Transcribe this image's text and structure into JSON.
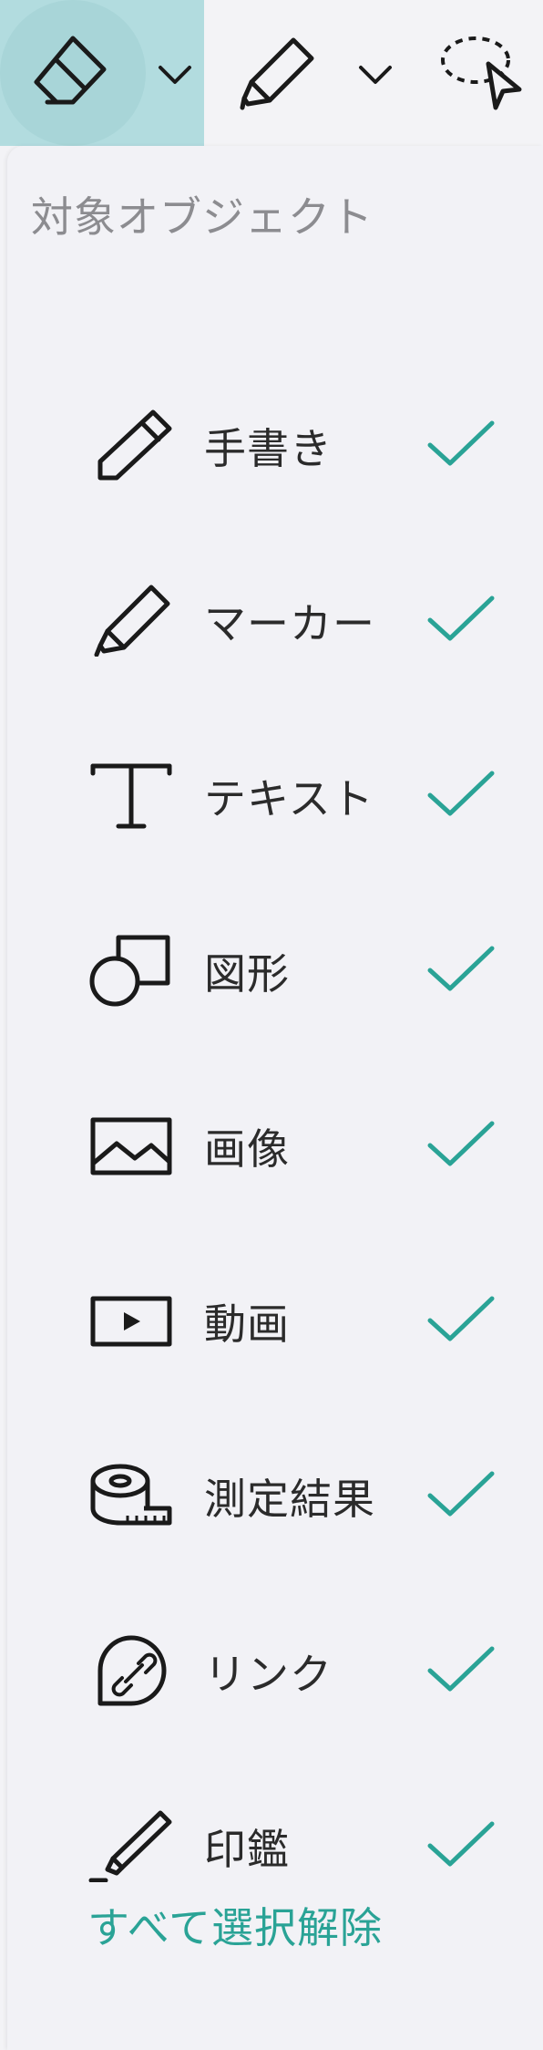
{
  "toolbar": {
    "tools": [
      {
        "name": "eraser-tool",
        "icon": "eraser-icon",
        "active": true
      },
      {
        "name": "pen-tool",
        "icon": "pen-icon",
        "active": false
      },
      {
        "name": "lasso-select-tool",
        "icon": "lasso-select-icon",
        "active": false
      }
    ]
  },
  "panel": {
    "title": "対象オブジェクト",
    "items": [
      {
        "label": "手書き",
        "icon": "pencil-icon",
        "checked": true
      },
      {
        "label": "マーカー",
        "icon": "marker-icon",
        "checked": true
      },
      {
        "label": "テキスト",
        "icon": "text-icon",
        "checked": true
      },
      {
        "label": "図形",
        "icon": "shape-icon",
        "checked": true
      },
      {
        "label": "画像",
        "icon": "image-icon",
        "checked": true
      },
      {
        "label": "動画",
        "icon": "video-icon",
        "checked": true
      },
      {
        "label": "測定結果",
        "icon": "tape-measure-icon",
        "checked": true
      },
      {
        "label": "リンク",
        "icon": "link-icon",
        "checked": true
      },
      {
        "label": "印鑑",
        "icon": "stamp-icon",
        "checked": true
      }
    ],
    "deselect_all": "すべて選択解除"
  },
  "colors": {
    "accent": "#2aa396",
    "active_tool_bg": "#b2dcdf",
    "panel_bg": "#f2f2f6",
    "text": "#2b2b2b",
    "muted_text": "#8c8c90"
  }
}
